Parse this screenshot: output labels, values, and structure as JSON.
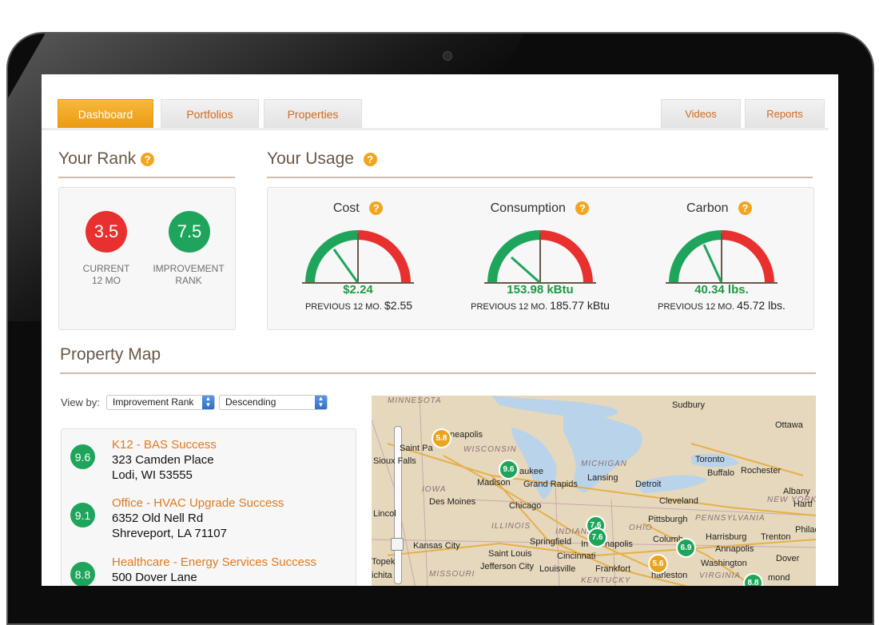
{
  "nav": {
    "tabs": [
      {
        "label": "Dashboard",
        "active": true
      },
      {
        "label": "Portfolios",
        "active": false
      },
      {
        "label": "Properties",
        "active": false
      }
    ],
    "right_tabs": [
      {
        "label": "Videos"
      },
      {
        "label": "Reports"
      }
    ]
  },
  "rank": {
    "title": "Your Rank",
    "help": "?",
    "current": {
      "value": "3.5",
      "label_line1": "CURRENT",
      "label_line2": "12 MO",
      "color": "#e8302f"
    },
    "improvement": {
      "value": "7.5",
      "label_line1": "IMPROVEMENT",
      "label_line2": "RANK",
      "color": "#1fa55b"
    }
  },
  "usage": {
    "title": "Your Usage",
    "help": "?",
    "gauges": [
      {
        "title": "Cost",
        "value": "$2.24",
        "prev_label": "PREVIOUS 12 MO.",
        "prev_value": "$2.55"
      },
      {
        "title": "Consumption",
        "value": "153.98 kBtu",
        "prev_label": "PREVIOUS 12 MO.",
        "prev_value": "185.77 kBtu"
      },
      {
        "title": "Carbon",
        "value": "40.34 lbs.",
        "prev_label": "PREVIOUS 12 MO.",
        "prev_value": "45.72 lbs."
      }
    ]
  },
  "map_section": {
    "title": "Property Map",
    "view_by_label": "View by:",
    "sort_field": "Improvement Rank",
    "sort_order": "Descending"
  },
  "properties": [
    {
      "rank": "9.6",
      "name": "K12 - BAS Success",
      "address": "323 Camden Place",
      "city": "Lodi, WI 53555"
    },
    {
      "rank": "9.1",
      "name": "Office - HVAC Upgrade Success",
      "address": "6352 Old Nell Rd",
      "city": "Shreveport, LA 71107"
    },
    {
      "rank": "8.8",
      "name": "Healthcare - Energy Services Success",
      "address": "500 Dover Lane",
      "city": ""
    }
  ],
  "map": {
    "states": [
      "MINNESOTA",
      "WISCONSIN",
      "MICHIGAN",
      "IOWA",
      "ILLINOIS",
      "INDIANA",
      "OHIO",
      "PENNSYLVANIA",
      "MISSOURI",
      "KENTUCKY",
      "VIRGINIA",
      "NEW YORK"
    ],
    "cities": [
      "Sudbury",
      "Ottawa",
      "neapolis",
      "Saint Pa",
      "Sioux Falls",
      "Madison",
      "aukee",
      "Grand Rapids",
      "Lansing",
      "Detroit",
      "Toronto",
      "Buffalo",
      "Rochester",
      "Albany",
      "Hartf",
      "Des Moines",
      "Chicago",
      "Cleveland",
      "Lincol",
      "Pittsburgh",
      "Harrisburg",
      "Trenton",
      "Philad",
      "Springfield",
      "In",
      "napolis",
      "Columb",
      "Annapolis",
      "Kansas City",
      "Saint Louis",
      "Cincinnati",
      "Topek",
      "Jefferson City",
      "Louisville",
      "Frankfort",
      "harleston",
      "Washington",
      "Dover",
      "ichita",
      "mond"
    ],
    "pins": [
      {
        "label": "5.8",
        "color": "orange"
      },
      {
        "label": "9.6",
        "color": "green"
      },
      {
        "label": "7.6",
        "color": "green"
      },
      {
        "label": "7.6",
        "color": "green"
      },
      {
        "label": "6.9",
        "color": "green"
      },
      {
        "label": "5.6",
        "color": "orange"
      },
      {
        "label": "8.8",
        "color": "green"
      }
    ]
  }
}
